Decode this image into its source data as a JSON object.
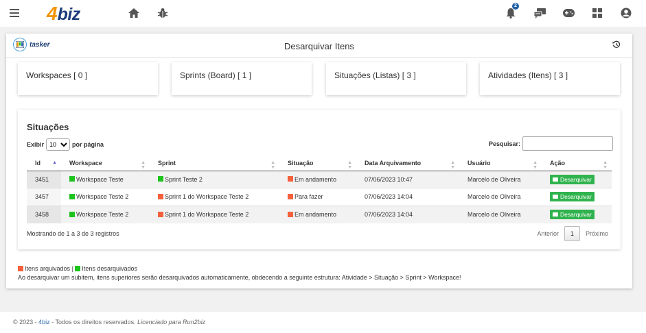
{
  "app": {
    "logo_four": "4",
    "logo_biz": "biz",
    "notification_count": "2",
    "icons": [
      "menu-icon",
      "home-icon",
      "bug-icon",
      "bell-icon",
      "chat-icon",
      "gamepad-icon",
      "apps-grid-icon",
      "user-icon"
    ]
  },
  "header": {
    "tasker_label": "tasker",
    "title": "Desarquivar Itens"
  },
  "stats": [
    {
      "label": "Workspaces [ 0 ]"
    },
    {
      "label": "Sprints (Board) [ 1 ]"
    },
    {
      "label": "Situações (Listas) [ 3 ]"
    },
    {
      "label": "Atividades (Itens) [ 3 ]"
    }
  ],
  "panel": {
    "title": "Situações",
    "show_prefix": "Exibir",
    "show_value": "10",
    "show_suffix": "por página",
    "search_label": "Pesquisar:",
    "search_value": ""
  },
  "table": {
    "columns": [
      "Id",
      "Workspace",
      "Sprint",
      "Situação",
      "Data Arquivamento",
      "Usuário",
      "Ação"
    ],
    "rows": [
      {
        "id": "3451",
        "workspace": "Workspace Teste",
        "workspace_status": "green",
        "sprint": "Sprint Teste 2",
        "sprint_status": "green",
        "situacao": "Em andamento",
        "situacao_status": "red",
        "data": "07/06/2023 10:47",
        "usuario": "Marcelo de Oliveira",
        "acao": "Desarquivar"
      },
      {
        "id": "3457",
        "workspace": "Workspace Teste 2",
        "workspace_status": "green",
        "sprint": "Sprint 1 do Workspace Teste 2",
        "sprint_status": "red",
        "situacao": "Para fazer",
        "situacao_status": "red",
        "data": "07/06/2023 14:04",
        "usuario": "Marcelo de Oliveira",
        "acao": "Desarquivar"
      },
      {
        "id": "3458",
        "workspace": "Workspace Teste 2",
        "workspace_status": "green",
        "sprint": "Sprint 1 do Workspace Teste 2",
        "sprint_status": "red",
        "situacao": "Em andamento",
        "situacao_status": "red",
        "data": "07/06/2023 14:04",
        "usuario": "Marcelo de Oliveira",
        "acao": "Desarquivar"
      }
    ]
  },
  "pagination": {
    "info": "Mostrando de 1 a 3 de 3 registros",
    "previous": "Anterior",
    "current": "1",
    "next": "Próximo"
  },
  "legend": {
    "archived": "Itens arquivados",
    "separator": "|",
    "unarchived": "Itens desarquivados",
    "note": "Ao desarquivar um subitem, itens superiores serão desarquivados automaticamente, obdecendo a seguinte estrutura: Atividade > Situação > Sprint > Workspace!"
  },
  "colors": {
    "archived": "#f5613c",
    "unarchived": "#1ec41e",
    "button": "#30b34e",
    "logo_orange": "#f29400",
    "logo_blue": "#1d3d7a"
  },
  "footer": {
    "copyright": "© 2023 -",
    "brand": "4biz",
    "rights": "- Todos os direitos reservados.",
    "licensed": "Licenciado para Run2biz"
  }
}
